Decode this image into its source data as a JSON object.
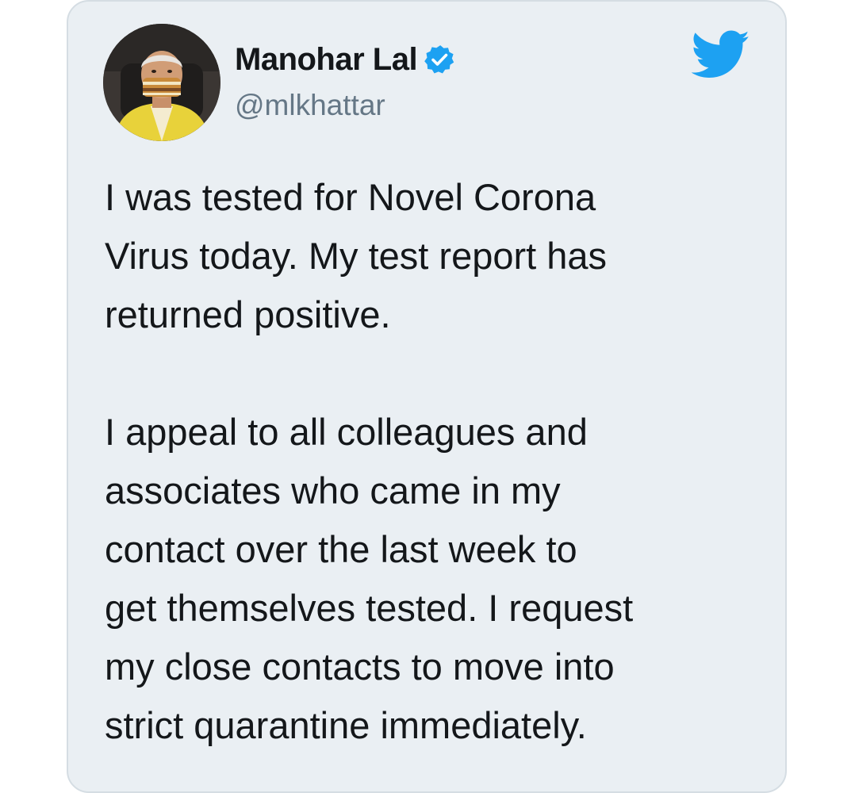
{
  "tweet": {
    "author": {
      "name": "Manohar Lal",
      "handle": "@mlkhattar",
      "verified": true,
      "avatar_icon": "profile-photo"
    },
    "logo_icon": "twitter-bird-icon",
    "paragraphs": [
      "I was tested for Novel Corona\nVirus today. My test report has\nreturned positive.",
      "I appeal to all colleagues and\nassociates who came in my\ncontact over the last week to\nget themselves tested. I request\nmy close contacts to move into\nstrict quarantine immediately."
    ]
  },
  "colors": {
    "card_background": "#eaeff3",
    "card_border": "#d5dde3",
    "text": "#14171a",
    "handle": "#657786",
    "twitter_blue": "#1da1f2"
  }
}
